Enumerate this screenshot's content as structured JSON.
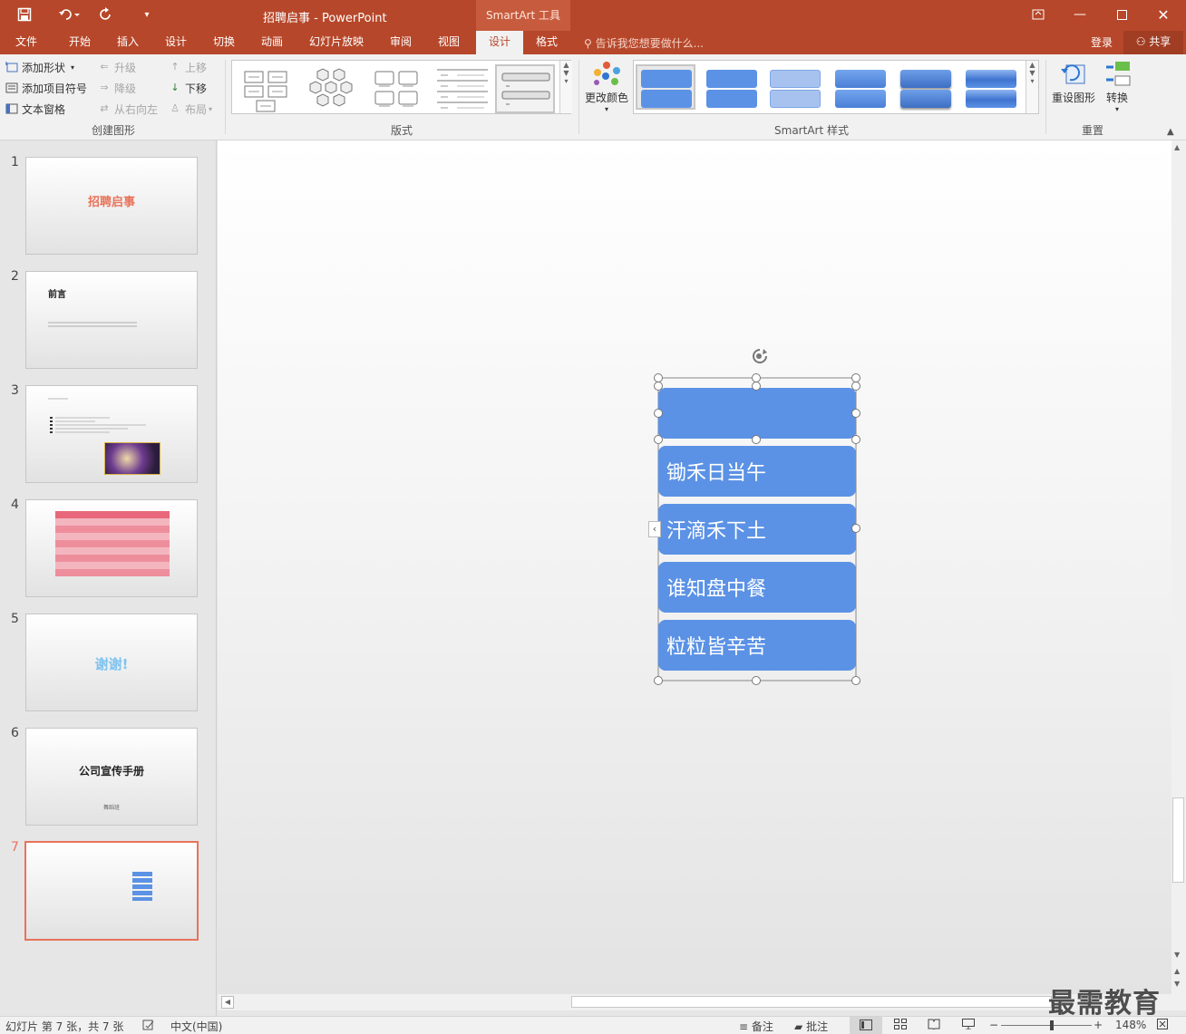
{
  "titlebar": {
    "title": "招聘启事 - PowerPoint",
    "context_group": "SmartArt 工具",
    "save_icon": "save-icon",
    "undo_icon": "undo-icon",
    "redo_icon": "redo-icon"
  },
  "tabs": [
    "文件",
    "开始",
    "插入",
    "设计",
    "切换",
    "动画",
    "幻灯片放映",
    "审阅",
    "视图",
    "设计",
    "格式"
  ],
  "active_tab_index": 9,
  "tell_me": "告诉我您想要做什么...",
  "account": {
    "login": "登录",
    "share": "共享"
  },
  "ribbon": {
    "create_graphic": {
      "label": "创建图形",
      "add_shape": "添加形状",
      "add_bullet": "添加项目符号",
      "text_pane": "文本窗格",
      "promote": "升级",
      "demote": "降级",
      "right_to_left": "从右向左",
      "move_up": "上移",
      "move_down": "下移",
      "layout": "布局"
    },
    "layouts": {
      "label": "版式"
    },
    "smartart_styles": {
      "label": "SmartArt 样式",
      "change_colors": "更改颜色"
    },
    "reset": {
      "label": "重置",
      "reset_graphic": "重设图形",
      "convert": "转换"
    }
  },
  "slides": [
    {
      "num": "1",
      "title": "招聘启事"
    },
    {
      "num": "2",
      "title": "前言"
    },
    {
      "num": "3",
      "title": ""
    },
    {
      "num": "4",
      "title": ""
    },
    {
      "num": "5",
      "title": "谢谢!"
    },
    {
      "num": "6",
      "title": "公司宣传手册",
      "subtitle": "舞蹈班"
    },
    {
      "num": "7",
      "title": ""
    }
  ],
  "smartart": {
    "items": [
      "",
      "锄禾日当午",
      "汗滴禾下土",
      "谁知盘中餐",
      "粒粒皆辛苦"
    ]
  },
  "statusbar": {
    "slide_info": "幻灯片 第 7 张，共 7 张",
    "language": "中文(中国)",
    "notes": "备注",
    "comments": "批注",
    "zoom": "148%"
  },
  "watermark": "最需教育",
  "colors": {
    "brand": "#b7472a",
    "smartart_fill": "#5b92e5",
    "selected_slide_border": "#e8735a"
  }
}
